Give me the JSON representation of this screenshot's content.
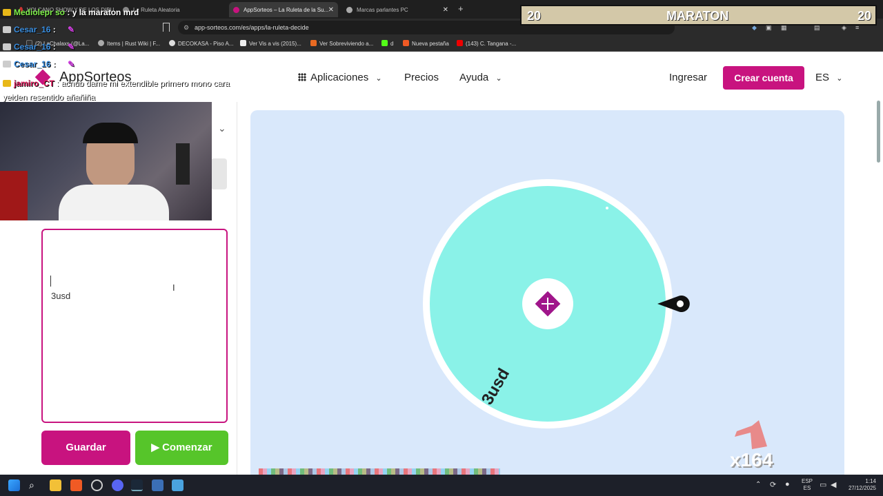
{
  "browser": {
    "tabs": [
      {
        "label": "VOLCANO SHOW Y DE LOS DIBU...",
        "active": false
      },
      {
        "label": "La Ruleta Aleatoria",
        "active": false
      },
      {
        "label": "AppSorteos – La Ruleta de la Su...",
        "active": true
      },
      {
        "label": "Marcas parlantes PC",
        "active": false
      }
    ],
    "new_tab": "+",
    "url": "app-sorteos.com/es/apps/la-ruleta-decide",
    "bookmarks": [
      "(2) LaChalaxs (@La...",
      "Items | Rust Wiki | F...",
      "DECOKASA - Piso A...",
      "Ver Vis a vis (2015)...",
      "Ver Sobreviviendo a...",
      "d",
      "Nueva pestaña",
      "(143) C. Tangana -..."
    ]
  },
  "site": {
    "logo": "AppSorteos",
    "nav": {
      "aplicaciones": "Aplicaciones",
      "precios": "Precios",
      "ayuda": "Ayuda",
      "ingresar": "Ingresar",
      "crear_cuenta": "Crear cuenta",
      "lang": "ES"
    },
    "editor": {
      "entry": "3usd",
      "save": "Guardar",
      "start": "Comenzar"
    },
    "wheel": {
      "segment_label": "3usd",
      "color": "#8af2e8"
    }
  },
  "overlay": {
    "maraton": {
      "title": "MARATON",
      "left": "20",
      "right": "20"
    },
    "chat": [
      {
        "user": "Mediolepr so",
        "text": "y la maraton mrd"
      },
      {
        "user": "Cesar_16",
        "text": ":"
      },
      {
        "user": "Cesar_16",
        "text": ":"
      },
      {
        "user": "Cesar_16",
        "text": ":"
      },
      {
        "user": "jamiro_CT",
        "text": "acnub dame mi extendible primero mono cara yeiden resentido añañiña"
      }
    ],
    "combo": "x164"
  },
  "taskbar": {
    "lang1": "ESP",
    "lang2": "ES",
    "time": "1:14",
    "date": "27/12/2025"
  }
}
